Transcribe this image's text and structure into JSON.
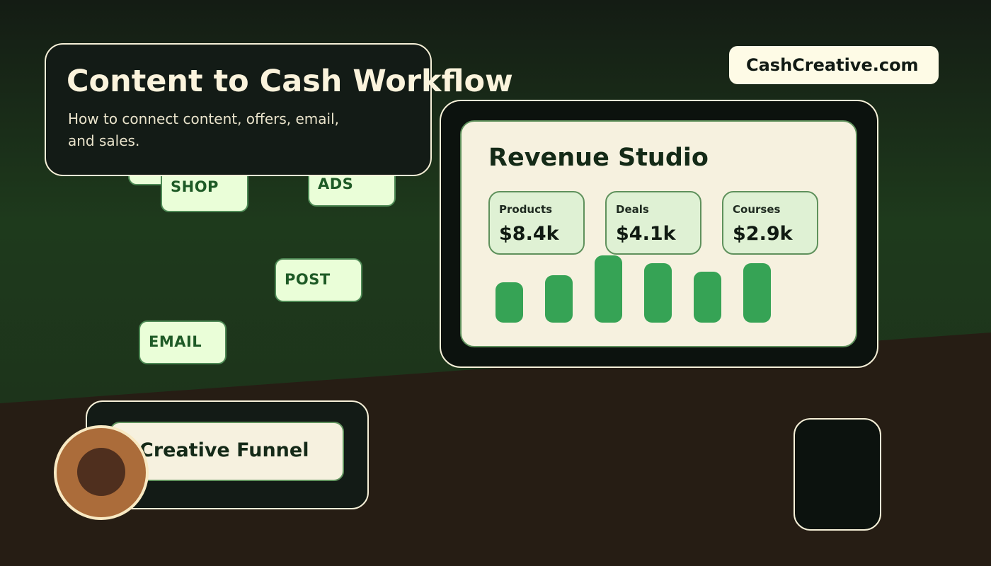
{
  "header": {
    "title": "Content to Cash Workflow",
    "subtitle": "How to connect content, offers, email, and sales."
  },
  "brand": {
    "label": "CashCreative.com"
  },
  "chips": [
    {
      "label": ""
    },
    {
      "label": "SHOP"
    },
    {
      "label": "ADS"
    },
    {
      "label": "POST"
    },
    {
      "label": "EMAIL"
    }
  ],
  "studio": {
    "title": "Revenue Studio",
    "metrics": [
      {
        "label": "Products",
        "value": "$8.4k"
      },
      {
        "label": "Deals",
        "value": "$4.1k"
      },
      {
        "label": "Courses",
        "value": "$2.9k"
      }
    ],
    "bars": [
      0.6,
      0.7,
      1.0,
      0.88,
      0.76,
      0.88
    ]
  },
  "funnel": {
    "label": "Creative Funnel"
  },
  "colors": {
    "background_top": "#151c15",
    "background_green": "#1f3a1d",
    "background_floor": "#261d14",
    "accent_green": "#36a355",
    "cream": "#f6f1df",
    "chip_bg": "#eafed8",
    "avatar": "#ab6c3a"
  },
  "icons": [
    "avatar-icon",
    "device-icon"
  ]
}
